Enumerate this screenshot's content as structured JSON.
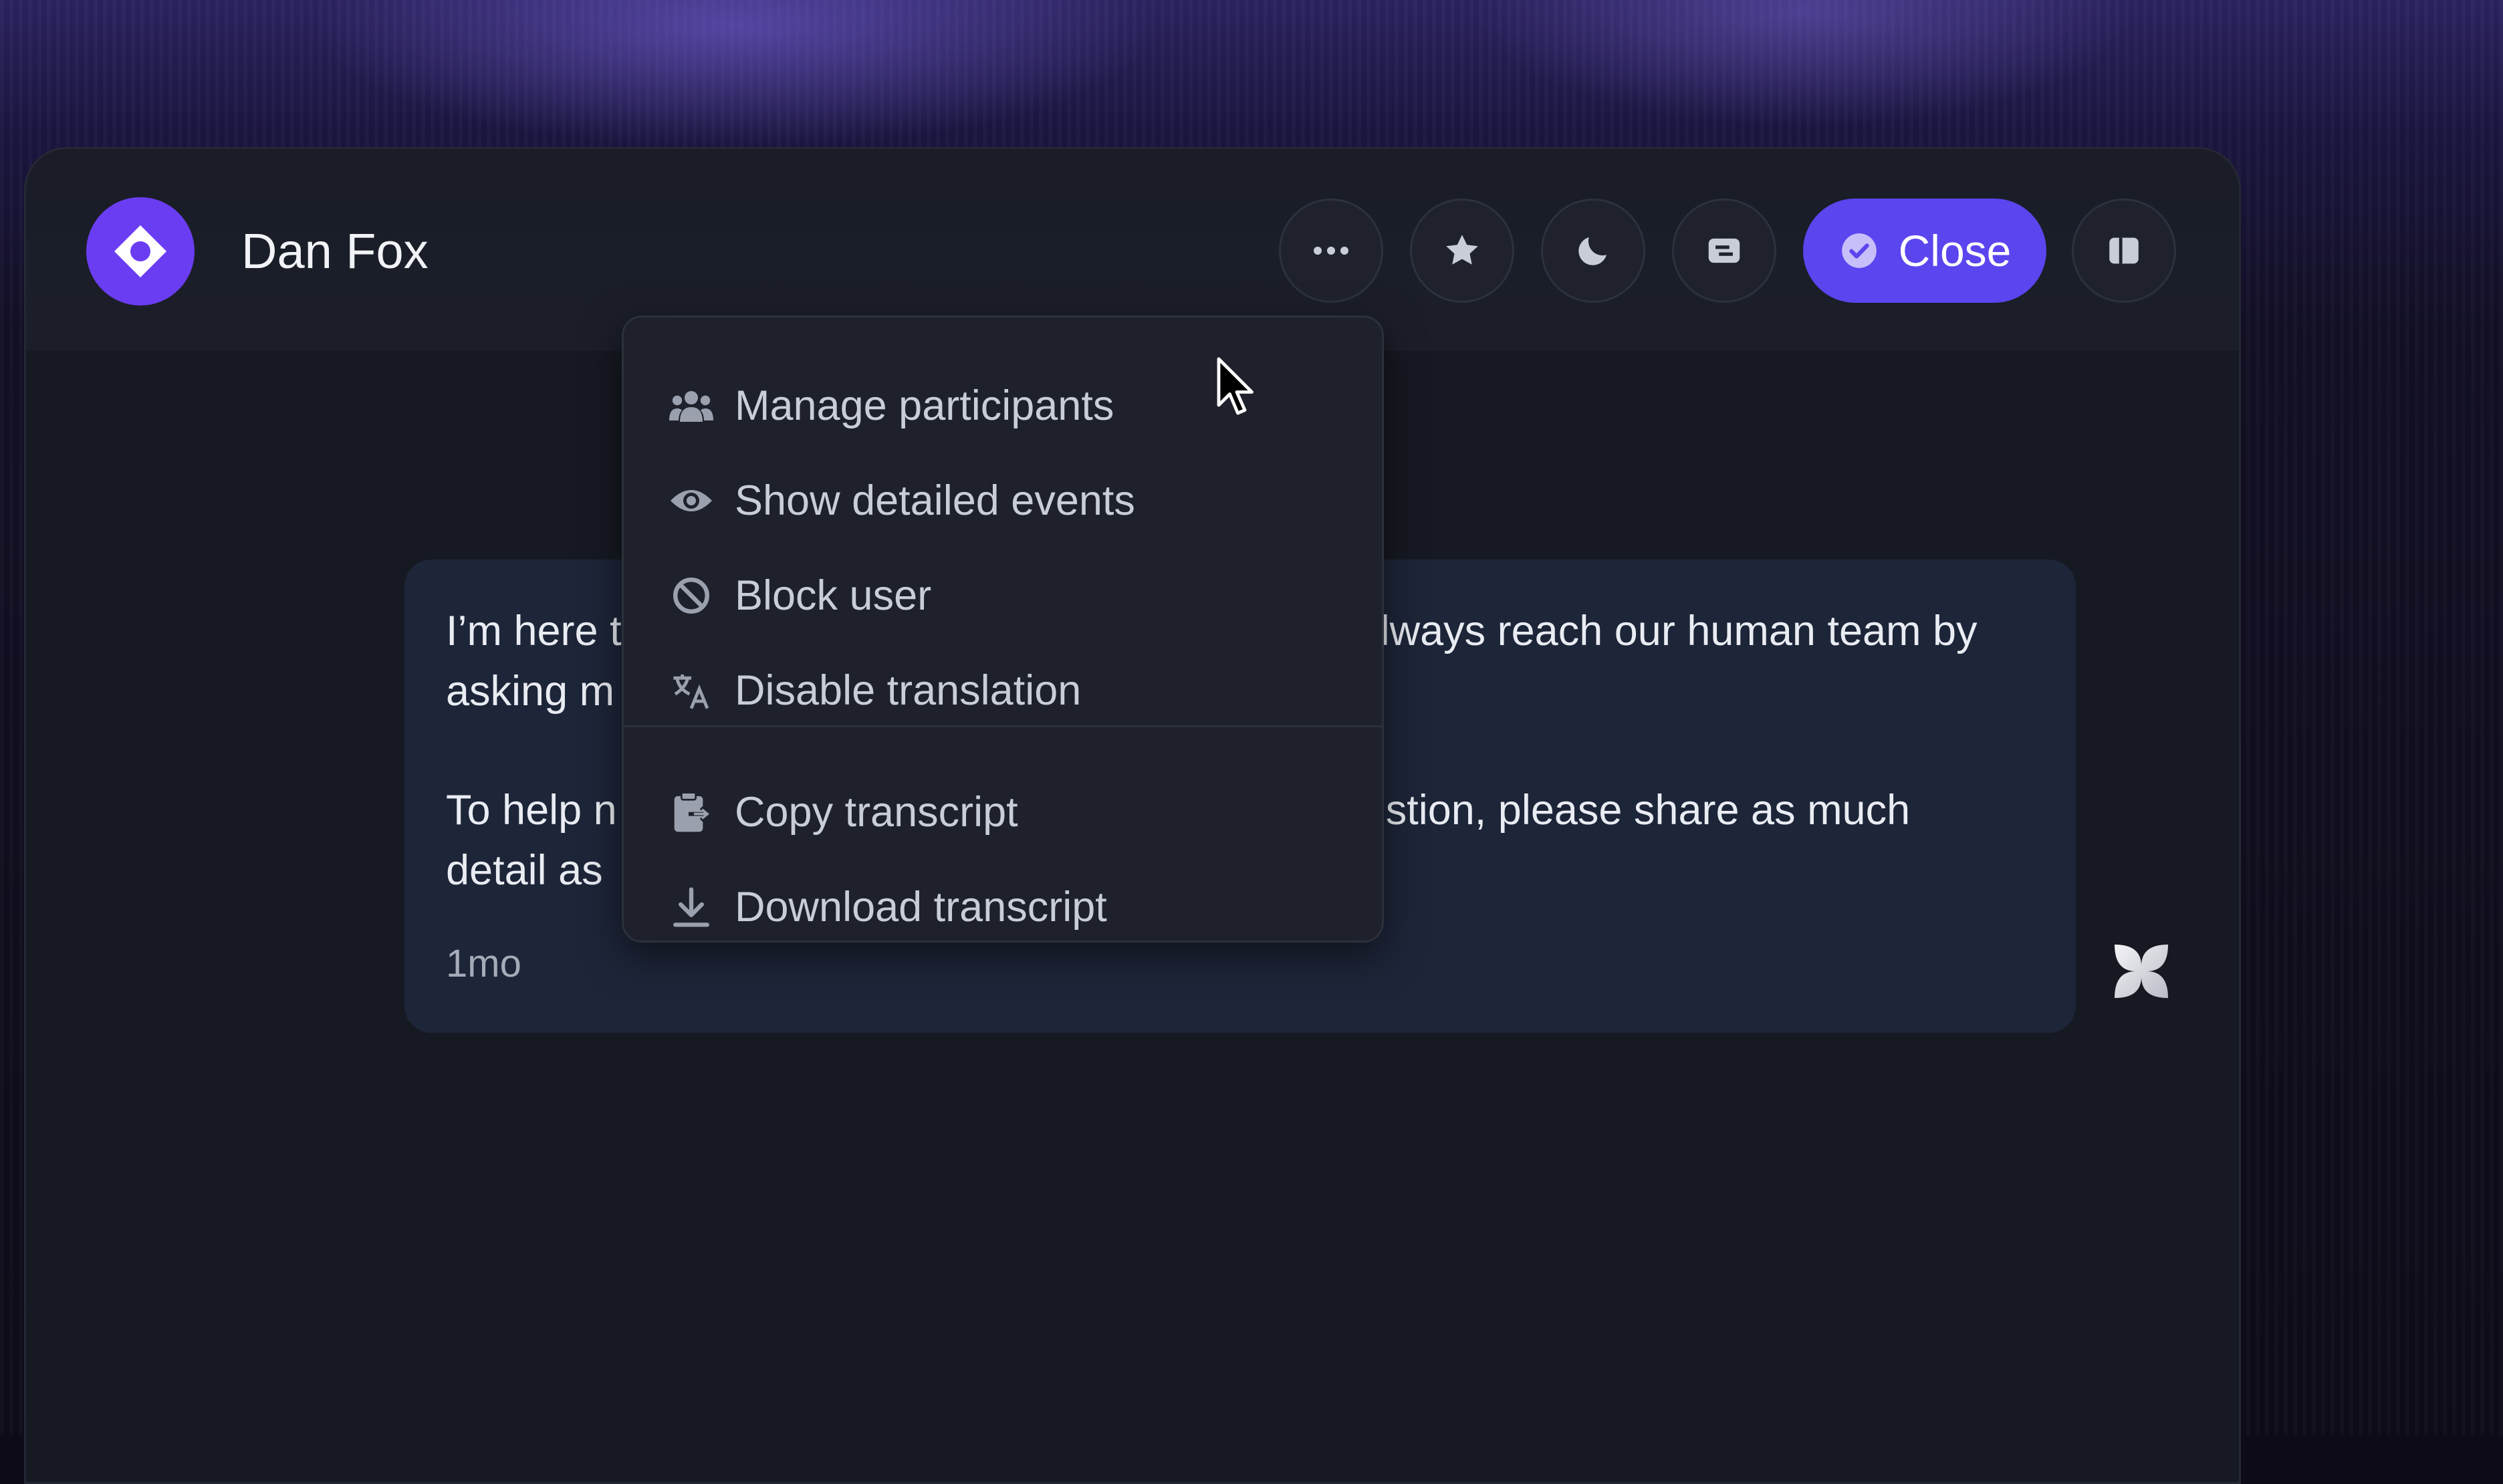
{
  "header": {
    "title": "Dan Fox",
    "close_label": "Close"
  },
  "message": {
    "line1_left": "I’m here t",
    "line1_right": "always reach our human team by",
    "line2_left": "asking m",
    "para2_line1_left": "To help n",
    "para2_line1_right": "stion, please share as much",
    "para2_line2_left": "detail as",
    "time": "1mo"
  },
  "menu": {
    "items": [
      {
        "label": "Manage participants",
        "icon": "people-icon"
      },
      {
        "label": "Show detailed events",
        "icon": "eye-icon"
      },
      {
        "label": "Block user",
        "icon": "block-icon"
      },
      {
        "label": "Disable translation",
        "icon": "translate-icon"
      },
      {
        "label": "Copy transcript",
        "icon": "clipboard-icon"
      },
      {
        "label": "Download transcript",
        "icon": "download-icon"
      }
    ]
  },
  "colors": {
    "accent": "#5a45ee",
    "logo": "#6b3df2",
    "bubble": "#1d2538",
    "background": "#161922"
  }
}
